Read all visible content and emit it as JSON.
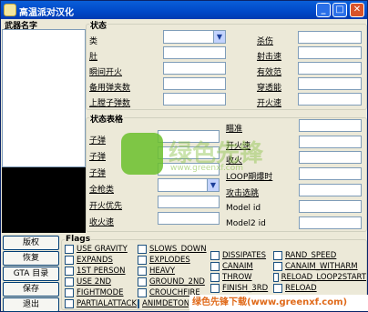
{
  "window": {
    "title": "高温派对汉化"
  },
  "left_panel": {
    "header": "武器名字"
  },
  "buttons": [
    "版权",
    "恢复",
    "GTA 目录",
    "保存",
    "退出"
  ],
  "status": {
    "title": "状态",
    "left_labels": [
      "类",
      "肚",
      "瞬间开火",
      "备用弹夹数",
      "上膛子弹数"
    ],
    "right_labels": [
      "杀伤",
      "射击速",
      "有效范",
      "穿透能",
      "开火速"
    ]
  },
  "status_table": {
    "title": "状态表格",
    "left_labels": [
      "子弹",
      "子弹",
      "子弹",
      "全枪类",
      "开火优先",
      "收火速"
    ],
    "right_labels": [
      "瞄准",
      "开火速",
      "收火",
      "LOOP期爆时",
      "攻击选跳",
      "Model id",
      "Model2 id"
    ]
  },
  "flags": {
    "title": "Flags",
    "col1": [
      "USE GRAVITY",
      "EXPANDS",
      "1ST PERSON",
      "USE 2ND",
      "FIGHTMODE",
      "PARTIALATTACK"
    ],
    "col2": [
      "SLOWS_DOWN",
      "EXPLODES",
      "HEAVY",
      "GROUND_2ND",
      "CROUCHFIRE",
      "ANIMDETONATE"
    ],
    "col3": [
      "DISSIPATES",
      "CANAIM",
      "THROW",
      "FINISH_3RD"
    ],
    "col4": [
      "RAND_SPEED",
      "CANAIM_WITHARM",
      "RELOAD_LOOP2START",
      "RELOAD"
    ]
  },
  "watermark": {
    "text": "绿色先锋",
    "url": "www.greenxf.com",
    "logo": "GREENXF.COM"
  },
  "banner": {
    "text": "绿色先锋下载(www.greenxf.com)"
  }
}
